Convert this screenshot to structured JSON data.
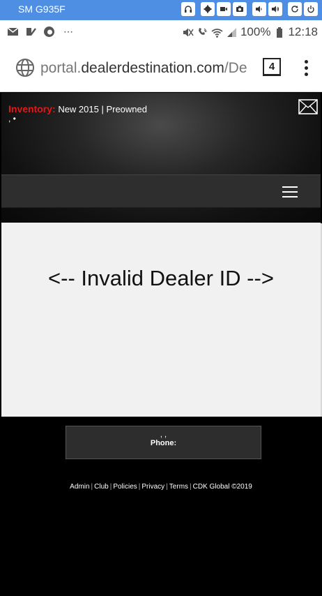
{
  "device": {
    "name": "SM G935F"
  },
  "status_bar": {
    "battery_percent": "100%",
    "time": "12:18",
    "overflow": "⋯"
  },
  "browser": {
    "url_scheme": "portal.",
    "url_host": "dealerdestination.com",
    "url_path": "/De",
    "tab_count": "4"
  },
  "header": {
    "inventory_label": "Inventory:",
    "inventory_links": "New 2015 | Preowned",
    "dots": ", •"
  },
  "main": {
    "message": "<-- Invalid Dealer ID -->"
  },
  "footer": {
    "commas": ", ,",
    "phone_label": "Phone:",
    "links": [
      "Admin",
      "Club",
      "Policies",
      "Privacy",
      "Terms"
    ],
    "copyright": "CDK Global ©2019"
  },
  "colors": {
    "device_bar": "#4f8fe3",
    "inventory_red": "#e01818",
    "nav_bar": "#2e2e2f",
    "content_bg": "#f1f1f1"
  }
}
